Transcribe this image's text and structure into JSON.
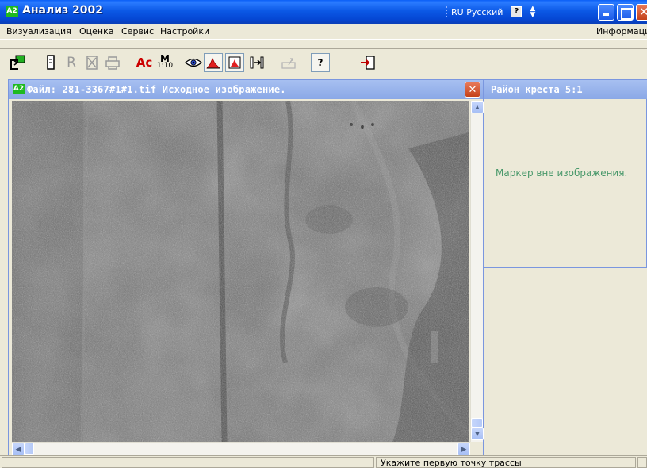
{
  "window": {
    "title": "Анализ 2002",
    "app_badge": "A2",
    "language": "RU Русский",
    "help_glyph": "?"
  },
  "menu": {
    "items": [
      "Визуализация",
      "Оценка",
      "Сервис",
      "Настройки"
    ],
    "right_item": "Информация"
  },
  "toolbar": {
    "labels": {
      "r": "R",
      "ac": "Ac",
      "m_top": "M",
      "m_bottom": "1:10",
      "help": "?"
    }
  },
  "image_window": {
    "badge": "A2",
    "title": "Файл: 281-3367#1#1.tif  Исходное изображение.",
    "close_glyph": "✕"
  },
  "cross_panel": {
    "title": "Район креста 5:1",
    "message": "Маркер вне изображения."
  },
  "status": {
    "text": "Укажите первую точку трассы"
  },
  "colors": {
    "titlebar": "#0a5ef7",
    "child_title": "#a7c0f1",
    "message_green": "#48986a",
    "window_bg": "#ece9d8"
  }
}
